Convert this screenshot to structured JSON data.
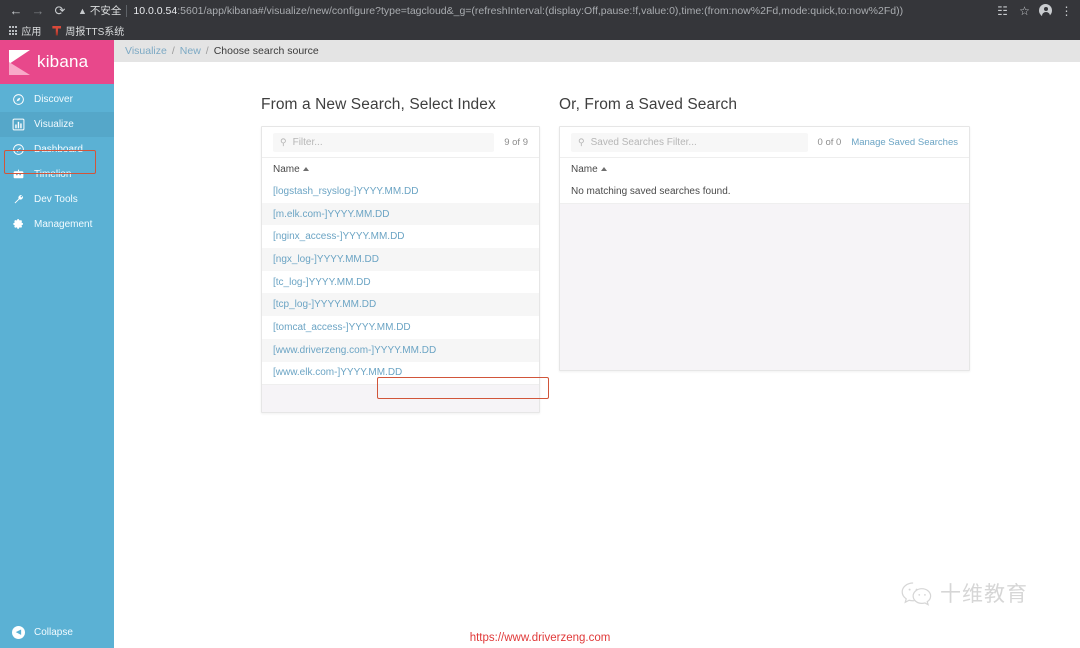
{
  "browser": {
    "back_icon": "back-arrow-icon",
    "forward_icon": "forward-arrow-icon",
    "reload_icon": "reload-icon",
    "security_warning": "不安全",
    "url_host": "10.0.0.54",
    "url_rest": ":5601/app/kibana#/visualize/new/configure?type=tagcloud&_g=(refreshInterval:(display:Off,pause:!f,value:0),time:(from:now%2Fd,mode:quick,to:now%2Fd))",
    "bookmarks": [
      {
        "label": "应用",
        "icon": "apps-grid-icon"
      },
      {
        "label": "周报TTS系统",
        "icon": "tts-app-icon"
      }
    ],
    "toolbar_icons": [
      "translate-icon",
      "bookmark-star-icon",
      "profile-avatar-icon",
      "chrome-menu-icon"
    ]
  },
  "sidebar": {
    "brand": "kibana",
    "items": [
      {
        "label": "Discover",
        "icon": "compass-icon",
        "active": false
      },
      {
        "label": "Visualize",
        "icon": "bar-chart-icon",
        "active": true
      },
      {
        "label": "Dashboard",
        "icon": "dashboard-clock-icon",
        "active": false
      },
      {
        "label": "Timelion",
        "icon": "timelion-icon",
        "active": false
      },
      {
        "label": "Dev Tools",
        "icon": "wrench-icon",
        "active": false
      },
      {
        "label": "Management",
        "icon": "gear-icon",
        "active": false
      }
    ],
    "collapse_label": "Collapse",
    "collapse_icon": "chevron-left-circle-icon"
  },
  "breadcrumb": {
    "items": [
      {
        "label": "Visualize",
        "link": true
      },
      {
        "label": "New",
        "link": true
      },
      {
        "label": "Choose search source",
        "link": false
      }
    ],
    "separator": "/"
  },
  "new_search_pane": {
    "title": "From a New Search, Select Index",
    "search_placeholder": "Filter...",
    "search_value": "",
    "search_icon": "search-icon",
    "count": "9 of 9",
    "column_header": "Name",
    "sort_icon": "sort-ascending-caret",
    "indices": [
      "[logstash_rsyslog-]YYYY.MM.DD",
      "[m.elk.com-]YYYY.MM.DD",
      "[nginx_access-]YYYY.MM.DD",
      "[ngx_log-]YYYY.MM.DD",
      "[tc_log-]YYYY.MM.DD",
      "[tcp_log-]YYYY.MM.DD",
      "[tomcat_access-]YYYY.MM.DD",
      "[www.driverzeng.com-]YYYY.MM.DD",
      "[www.elk.com-]YYYY.MM.DD"
    ]
  },
  "saved_search_pane": {
    "title": "Or, From a Saved Search",
    "search_placeholder": "Saved Searches Filter...",
    "search_value": "",
    "search_icon": "search-icon",
    "count": "0 of 0",
    "manage_link": "Manage Saved Searches",
    "column_header": "Name",
    "sort_icon": "sort-ascending-caret",
    "empty_message": "No matching saved searches found."
  },
  "annotations": {
    "highlight_color": "#d1553a",
    "highlighted_sidebar_item": "Visualize",
    "highlighted_index": "[www.driverzeng.com-]YYYY.MM.DD"
  },
  "watermark": {
    "text": "十维教育",
    "icon": "wechat-chat-icon"
  },
  "footer": {
    "url": "https://www.driverzeng.com"
  },
  "colors": {
    "brand_pink": "#e8488b",
    "sidebar_blue": "#5bb1d4",
    "link_blue": "#6ba4c4",
    "highlight_red": "#d1553a",
    "footer_red": "#e03a3a"
  }
}
